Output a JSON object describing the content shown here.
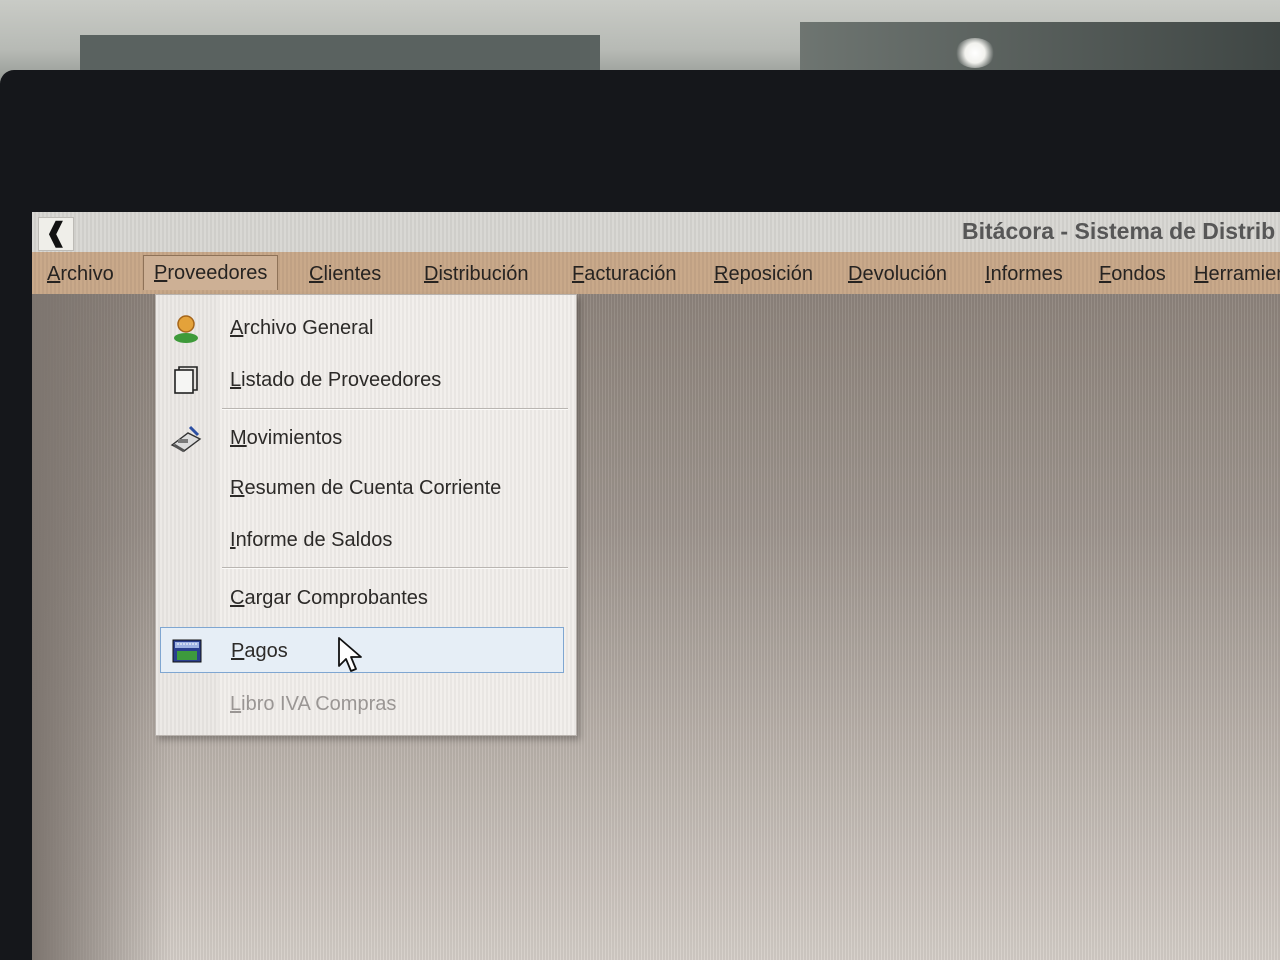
{
  "window": {
    "app_icon_glyph": "❰",
    "title": "Bitácora - Sistema de Distrib"
  },
  "menubar": {
    "items": [
      {
        "prefix": "",
        "acc": "A",
        "rest": "rchivo",
        "active": false
      },
      {
        "prefix": "",
        "acc": "P",
        "rest": "roveedores",
        "active": true
      },
      {
        "prefix": "",
        "acc": "C",
        "rest": "lientes",
        "active": false
      },
      {
        "prefix": "",
        "acc": "D",
        "rest": "istribución",
        "active": false
      },
      {
        "prefix": "",
        "acc": "F",
        "rest": "acturación",
        "active": false
      },
      {
        "prefix": "",
        "acc": "R",
        "rest": "eposición",
        "active": false
      },
      {
        "prefix": "",
        "acc": "D",
        "rest": "evolución",
        "active": false
      },
      {
        "prefix": "",
        "acc": "I",
        "rest": "nformes",
        "active": false
      },
      {
        "prefix": "",
        "acc": "F",
        "rest": "ondos",
        "active": false
      },
      {
        "prefix": "",
        "acc": "H",
        "rest": "erramien",
        "active": false
      }
    ]
  },
  "proveedores_menu": {
    "items": [
      {
        "acc": "A",
        "rest": "rchivo General",
        "icon": "person-icon",
        "enabled": true,
        "highlighted": false
      },
      {
        "acc": "L",
        "rest": "istado de Proveedores",
        "icon": "document-stack-icon",
        "enabled": true,
        "highlighted": false
      },
      {
        "acc": "M",
        "rest": "ovimientos",
        "icon": "cash-register-icon",
        "enabled": true,
        "highlighted": false
      },
      {
        "acc": "R",
        "rest": "esumen de Cuenta Corriente",
        "icon": "",
        "enabled": true,
        "highlighted": false
      },
      {
        "acc": "I",
        "rest": "nforme de Saldos",
        "icon": "",
        "enabled": true,
        "highlighted": false
      },
      {
        "acc": "C",
        "rest": "argar Comprobantes",
        "icon": "",
        "enabled": true,
        "highlighted": false
      },
      {
        "acc": "P",
        "rest": "agos",
        "icon": "payment-card-icon",
        "enabled": true,
        "highlighted": true
      },
      {
        "acc": "L",
        "rest": "ibro IVA Compras",
        "icon": "",
        "enabled": false,
        "highlighted": false
      }
    ]
  },
  "colors": {
    "menubar": "#c9a98a",
    "highlight_border": "#7fa6d1",
    "disabled_text": "#9a9694"
  }
}
